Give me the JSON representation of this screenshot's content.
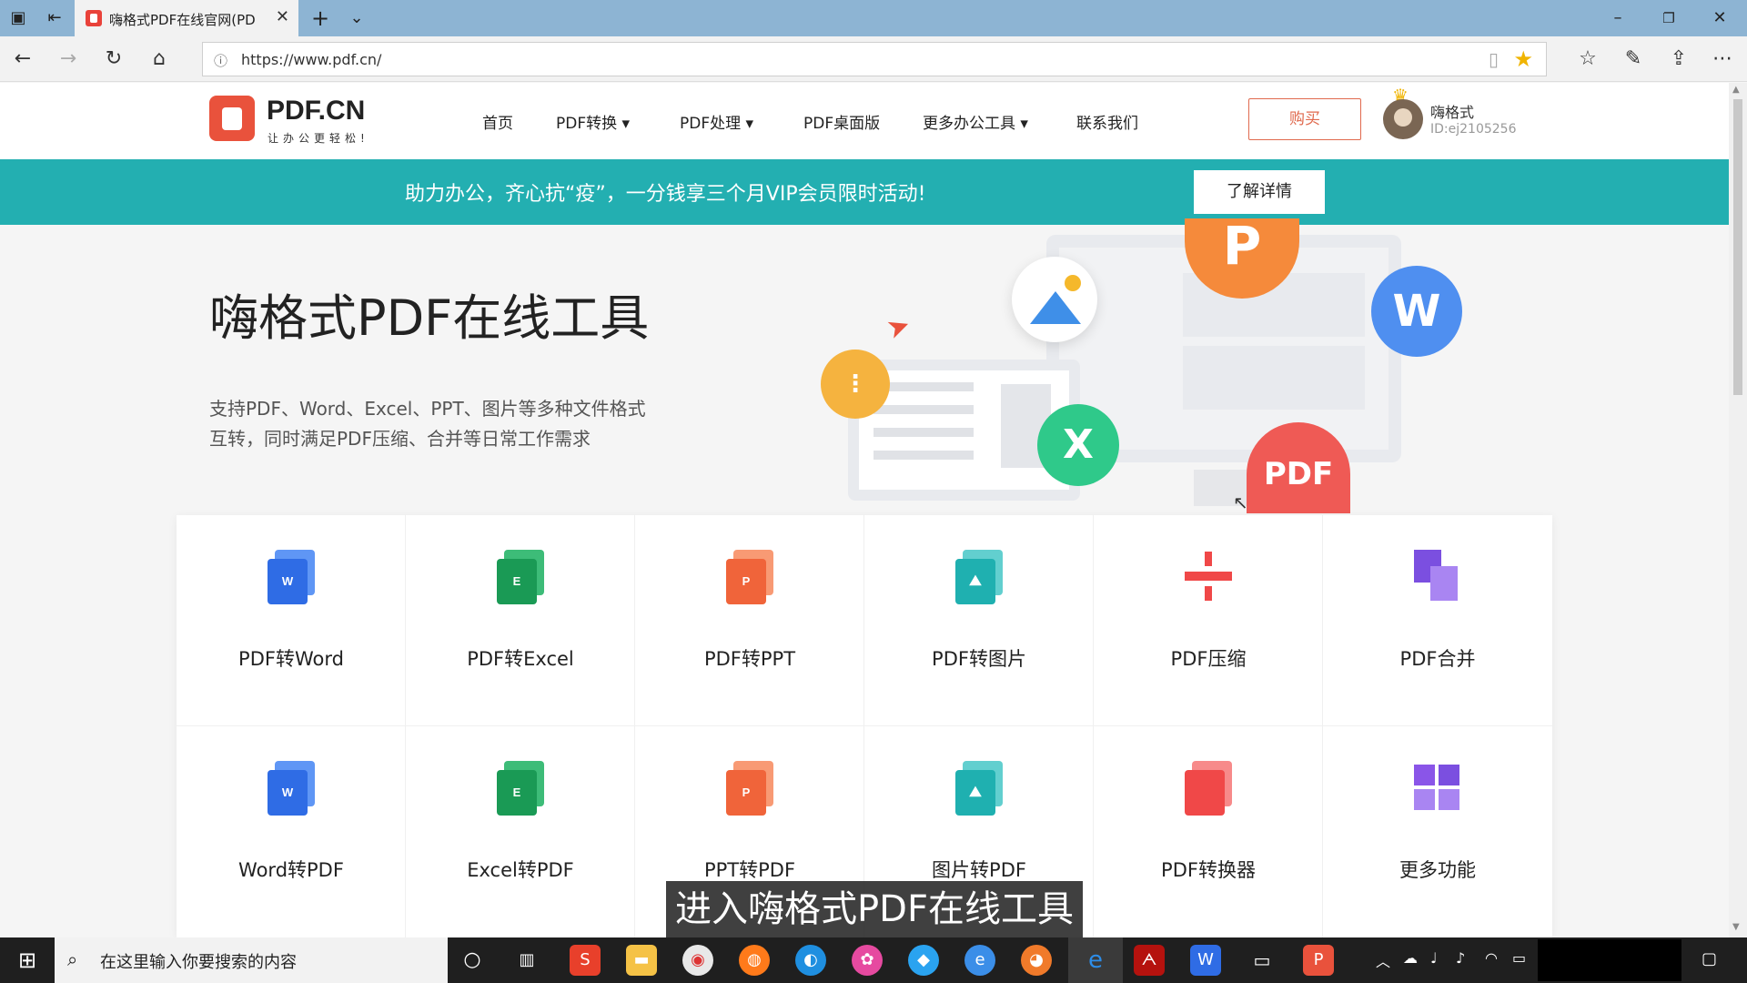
{
  "browser": {
    "tab_title": "嗨格式PDF在线官网(PD",
    "url": "https://www.pdf.cn/",
    "tab_close": "✕",
    "new_tab": "+",
    "tab_list": "⌄"
  },
  "site": {
    "logo_text": "PDF.CN",
    "logo_slogan": "让办公更轻松!",
    "nav": [
      {
        "label": "首页"
      },
      {
        "label": "PDF转换 ▾"
      },
      {
        "label": "PDF处理 ▾"
      },
      {
        "label": "PDF桌面版"
      },
      {
        "label": "更多办公工具 ▾"
      },
      {
        "label": "联系我们"
      }
    ],
    "buy_label": "购买",
    "user_name": "嗨格式",
    "user_id": "ID:ej2105256"
  },
  "banner": {
    "text": "助力办公，齐心抗“疫”，一分钱享三个月VIP会员限时活动!",
    "button": "了解详情"
  },
  "hero": {
    "title": "嗨格式PDF在线工具",
    "desc_line1": "支持PDF、Word、Excel、PPT、图片等多种文件格式",
    "desc_line2": "互转，同时满足PDF压缩、合并等日常工作需求",
    "bubbles": {
      "p": "P",
      "w": "W",
      "x": "X",
      "pdf": "PDF"
    }
  },
  "tools": [
    {
      "label": "PDF转Word",
      "letter": "W",
      "color": "#2f6ce5",
      "back": "#5f96f5"
    },
    {
      "label": "PDF转Excel",
      "letter": "E",
      "color": "#1a9a55",
      "back": "#3dbc78"
    },
    {
      "label": "PDF转PPT",
      "letter": "P",
      "color": "#f0643a",
      "back": "#f89a74"
    },
    {
      "label": "PDF转图片",
      "letter": "",
      "color": "#1fb0b0",
      "back": "#62cfcf"
    },
    {
      "label": "PDF压缩",
      "letter": "",
      "color": "#f04848",
      "back": "#f04848"
    },
    {
      "label": "PDF合并",
      "letter": "",
      "color": "#7b4fe0",
      "back": "#a985f2"
    },
    {
      "label": "Word转PDF",
      "letter": "W",
      "color": "#2f6ce5",
      "back": "#5f96f5"
    },
    {
      "label": "Excel转PDF",
      "letter": "E",
      "color": "#1a9a55",
      "back": "#3dbc78"
    },
    {
      "label": "PPT转PDF",
      "letter": "P",
      "color": "#f0643a",
      "back": "#f89a74"
    },
    {
      "label": "图片转PDF",
      "letter": "",
      "color": "#1fb0b0",
      "back": "#62cfcf"
    },
    {
      "label": "PDF转换器",
      "letter": "",
      "color": "#f04848",
      "back": "#f78a8a"
    },
    {
      "label": "更多功能",
      "letter": "",
      "color": "#8a55e8",
      "back": "#a985f2"
    }
  ],
  "caption": "进入嗨格式PDF在线工具",
  "taskbar": {
    "search_placeholder": "在这里输入你要搜索的内容"
  }
}
